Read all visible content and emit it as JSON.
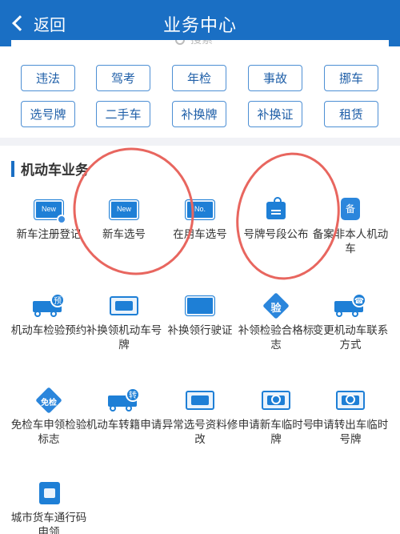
{
  "header": {
    "back_label": "返回",
    "title": "业务中心"
  },
  "search": {
    "placeholder": "搜索"
  },
  "quick_buttons": [
    "违法",
    "驾考",
    "年检",
    "事故",
    "挪车",
    "选号牌",
    "二手车",
    "补换牌",
    "补换证",
    "租赁"
  ],
  "section": {
    "title": "机动车业务"
  },
  "services": [
    {
      "label": "新车注册登记",
      "icon": "new-plate-check-icon",
      "badge": "New"
    },
    {
      "label": "新车选号",
      "icon": "new-plate-icon",
      "badge": "New"
    },
    {
      "label": "在用车选号",
      "icon": "plate-number-icon",
      "badge": "No."
    },
    {
      "label": "号牌号段公布",
      "icon": "announcement-tag-icon",
      "badge": ""
    },
    {
      "label": "备案非本人机动车",
      "icon": "record-icon",
      "badge": "备"
    },
    {
      "label": "机动车检验预约",
      "icon": "truck-booking-icon",
      "badge": "预"
    },
    {
      "label": "补换领机动车号牌",
      "icon": "plate-swap-icon",
      "badge": ""
    },
    {
      "label": "补换领行驶证",
      "icon": "license-swap-icon",
      "badge": ""
    },
    {
      "label": "补领检验合格标志",
      "icon": "inspection-diamond-icon",
      "badge": "验"
    },
    {
      "label": "变更机动车联系方式",
      "icon": "truck-phone-icon",
      "badge": "☎"
    },
    {
      "label": "免检车申领检验标志",
      "icon": "exempt-diamond-icon",
      "badge": "免检"
    },
    {
      "label": "机动车转籍申请",
      "icon": "truck-transfer-icon",
      "badge": "转"
    },
    {
      "label": "异常选号资料修改",
      "icon": "edit-plate-icon",
      "badge": ""
    },
    {
      "label": "申请新车临时号牌",
      "icon": "temp-plate-icon",
      "badge": ""
    },
    {
      "label": "申请转出车临时号牌",
      "icon": "temp-plate-out-icon",
      "badge": ""
    },
    {
      "label": "城市货车通行码申领",
      "icon": "city-truck-pass-icon",
      "badge": ""
    }
  ]
}
